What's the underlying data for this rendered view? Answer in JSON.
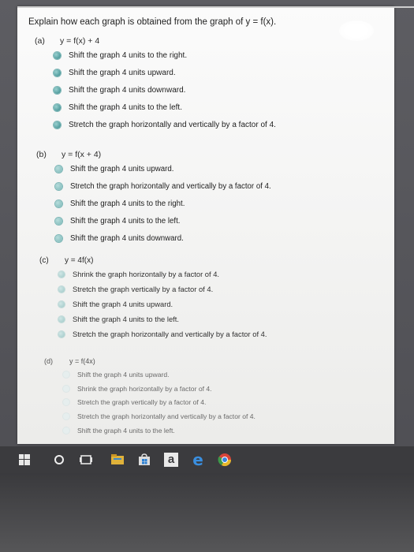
{
  "question": "Explain how each graph is obtained from the graph of y = f(x).",
  "parts": [
    {
      "label": "(a)",
      "equation": "y = f(x) + 4",
      "options": [
        "Shift the graph 4 units to the right.",
        "Shift the graph 4 units upward.",
        "Shift the graph 4 units downward.",
        "Shift the graph 4 units to the left.",
        "Stretch the graph horizontally and vertically by a factor of 4."
      ]
    },
    {
      "label": "(b)",
      "equation": "y = f(x + 4)",
      "options": [
        "Shift the graph 4 units upward.",
        "Stretch the graph horizontally and vertically by a factor of 4.",
        "Shift the graph 4 units to the right.",
        "Shift the graph 4 units to the left.",
        "Shift the graph 4 units downward."
      ]
    },
    {
      "label": "(c)",
      "equation": "y = 4f(x)",
      "options": [
        "Shrink the graph horizontally by a factor of 4.",
        "Stretch the graph vertically by a factor of 4.",
        "Shift the graph 4 units upward.",
        "Shift the graph 4 units to the left.",
        "Stretch the graph horizontally and vertically by a factor of 4."
      ]
    },
    {
      "label": "(d)",
      "equation": "y = f(4x)",
      "options": [
        "Shift the graph 4 units upward.",
        "Shrink the graph horizontally by a factor of 4.",
        "Stretch the graph vertically by a factor of 4.",
        "Stretch the graph horizontally and vertically by a factor of 4.",
        "Shift the graph 4 units to the left."
      ]
    }
  ],
  "taskbar": {
    "icons": [
      "windows-start-icon",
      "cortana-search-icon",
      "task-view-icon",
      "file-explorer-icon",
      "store-icon",
      "app-a-icon",
      "edge-icon",
      "chrome-icon"
    ],
    "app_letter": "a",
    "colors": {
      "edge": "#3a8fe0",
      "store_blue": "#2a7fd4",
      "accent": "#5aa3a4"
    }
  }
}
